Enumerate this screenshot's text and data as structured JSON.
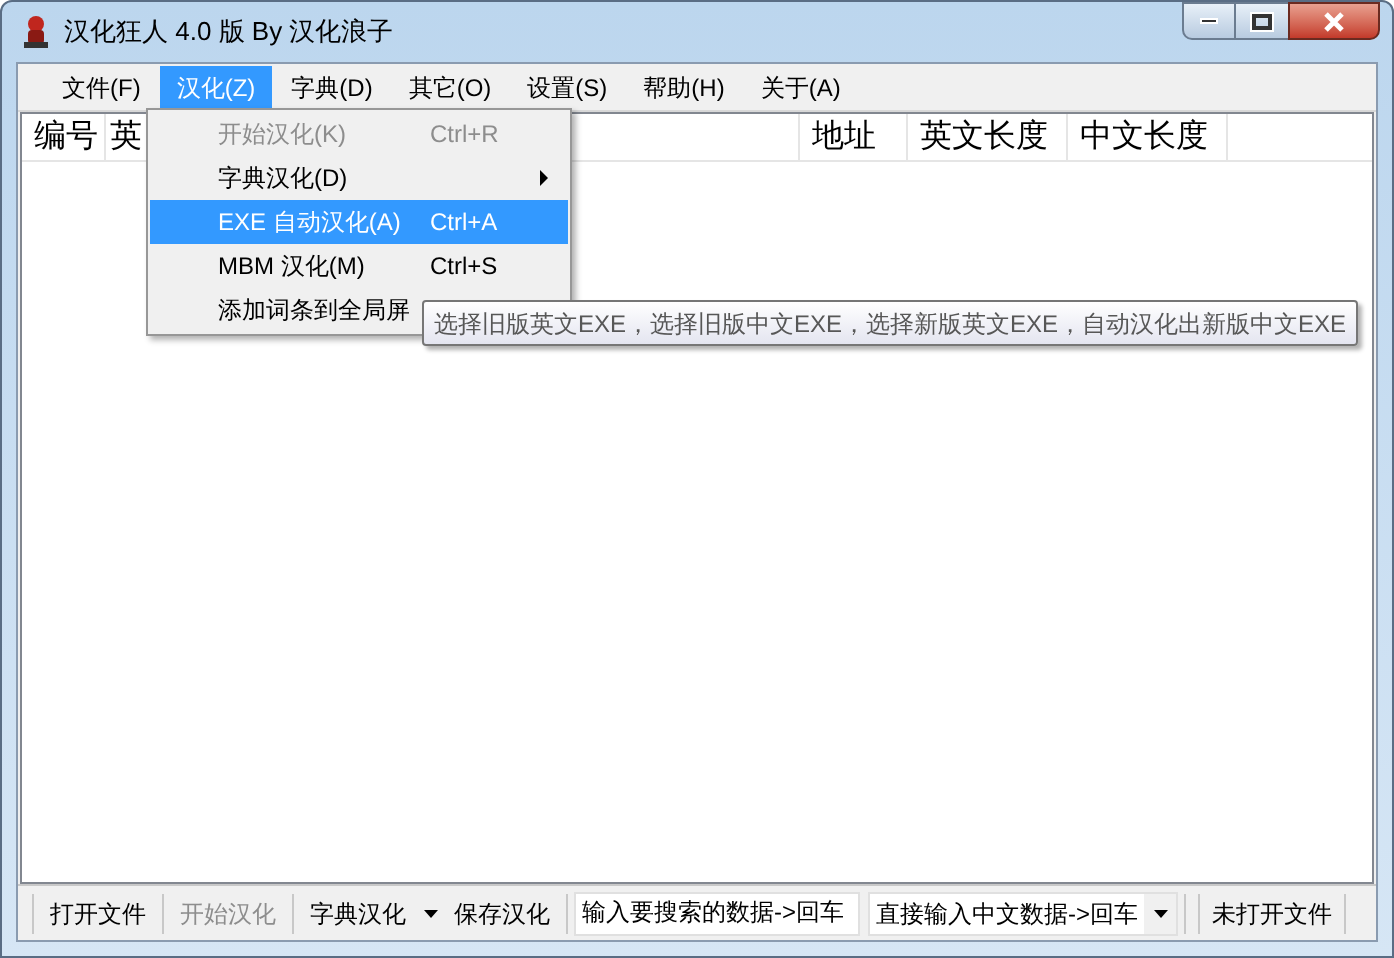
{
  "window": {
    "title": "汉化狂人 4.0 版 By 汉化浪子"
  },
  "menu_bar": [
    {
      "label": "文件(F)",
      "selected": false
    },
    {
      "label": "汉化(Z)",
      "selected": true
    },
    {
      "label": "字典(D)",
      "selected": false
    },
    {
      "label": "其它(O)",
      "selected": false
    },
    {
      "label": "设置(S)",
      "selected": false
    },
    {
      "label": "帮助(H)",
      "selected": false
    },
    {
      "label": "关于(A)",
      "selected": false
    }
  ],
  "dropdown": {
    "items": [
      {
        "label": "开始汉化(K)",
        "shortcut": "Ctrl+R",
        "disabled": true,
        "selected": false,
        "submenu": false
      },
      {
        "label": "字典汉化(D)",
        "disabled": false,
        "selected": false,
        "submenu": true
      },
      {
        "label": "EXE 自动汉化(A)",
        "shortcut": "Ctrl+A",
        "disabled": false,
        "selected": true,
        "submenu": false
      },
      {
        "label": "MBM 汉化(M)",
        "shortcut": "Ctrl+S",
        "disabled": false,
        "selected": false,
        "submenu": false
      },
      {
        "label": "添加词条到全局屏",
        "disabled": false,
        "selected": false,
        "submenu": false
      }
    ]
  },
  "tooltip": "选择旧版英文EXE，选择旧版中文EXE，选择新版英文EXE，自动汉化出新版中文EXE",
  "table": {
    "columns": [
      "编号",
      "英",
      "地址",
      "英文长度",
      "中文长度"
    ]
  },
  "toolbar": {
    "items": [
      {
        "kind": "button",
        "label": "打开文件",
        "disabled": false
      },
      {
        "kind": "button",
        "label": "开始汉化",
        "disabled": true
      },
      {
        "kind": "split",
        "label": "字典汉化",
        "disabled": false
      },
      {
        "kind": "button",
        "label": "保存汉化",
        "disabled": false
      },
      {
        "kind": "input",
        "value": "输入要搜索的数据->回车"
      },
      {
        "kind": "combo",
        "value": "直接输入中文数据->回车"
      },
      {
        "kind": "label",
        "label": "未打开文件"
      }
    ]
  }
}
